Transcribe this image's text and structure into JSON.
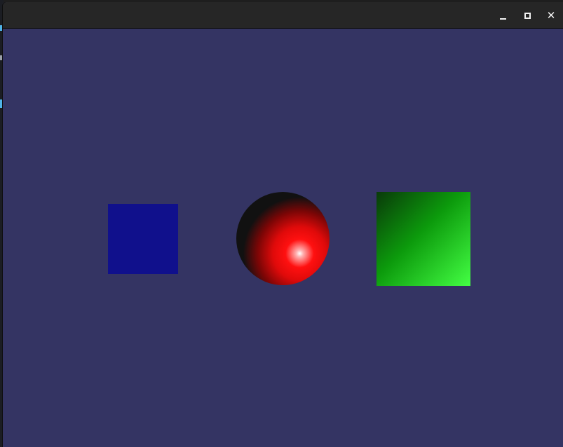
{
  "window": {
    "title": "",
    "background_color": "#343463",
    "titlebar_color": "#262626",
    "controls": {
      "minimize_icon": "minimize-icon",
      "maximize_icon": "maximize-icon",
      "close_icon": "close-icon",
      "close_glyph": "✕"
    }
  },
  "scene": {
    "objects": [
      {
        "name": "blue-square",
        "kind": "square",
        "color": "#10108c"
      },
      {
        "name": "red-sphere",
        "kind": "sphere",
        "color": "#ff1010",
        "shade_color": "#111111",
        "highlight_color": "#ffffff"
      },
      {
        "name": "green-square",
        "kind": "square",
        "color_dark": "#0a3a0a",
        "color_mid": "#0c9a0c",
        "color_light": "#44ff44"
      }
    ]
  }
}
